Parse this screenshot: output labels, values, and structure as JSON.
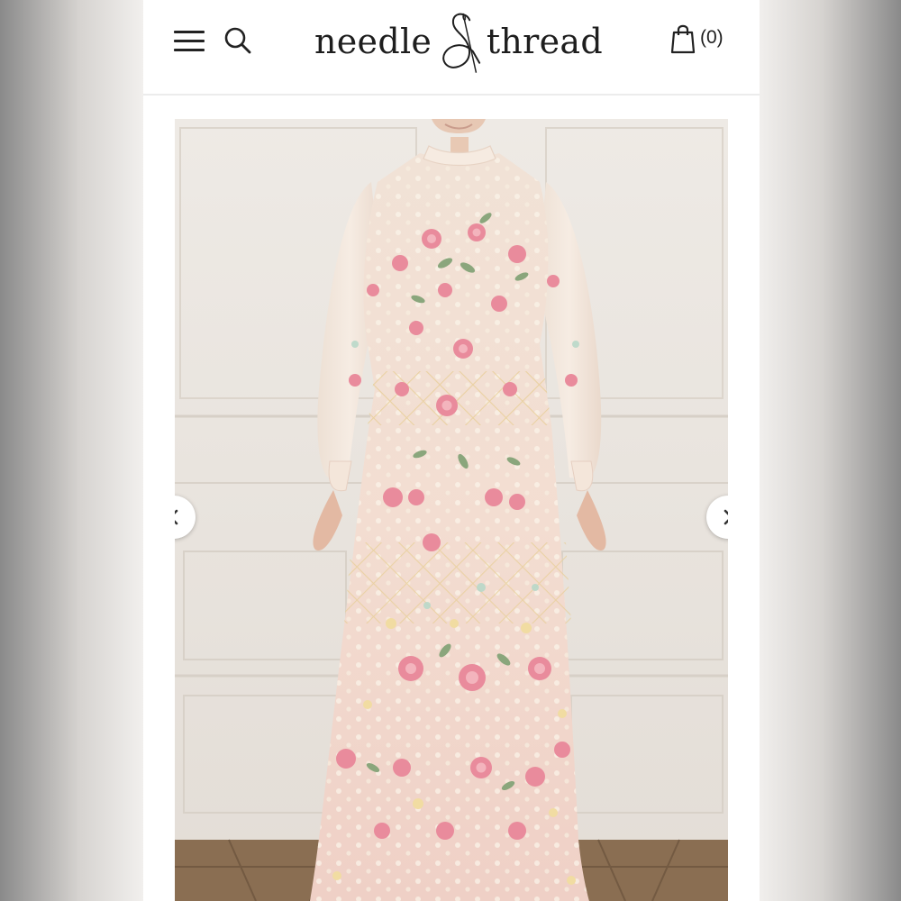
{
  "brand": {
    "word_left": "needle",
    "word_right": "thread",
    "ampersand": "&",
    "text_color": "#1e1e1e"
  },
  "header": {
    "menu_icon": "hamburger-menu-icon",
    "search_icon": "search-icon",
    "cart_icon": "shopping-bag-icon",
    "cart_count": "(0)"
  },
  "gallery": {
    "prev_icon": "chevron-left-icon",
    "next_icon": "chevron-right-icon",
    "image_subject": "floral sequin embellished long-sleeve maxi gown",
    "colors": {
      "gown": "#f3dcd0",
      "flower_pink": "#e98b9c",
      "leaf_green": "#8aa67c",
      "wall": "#ebe6e0",
      "floor": "#8a6e52"
    }
  }
}
